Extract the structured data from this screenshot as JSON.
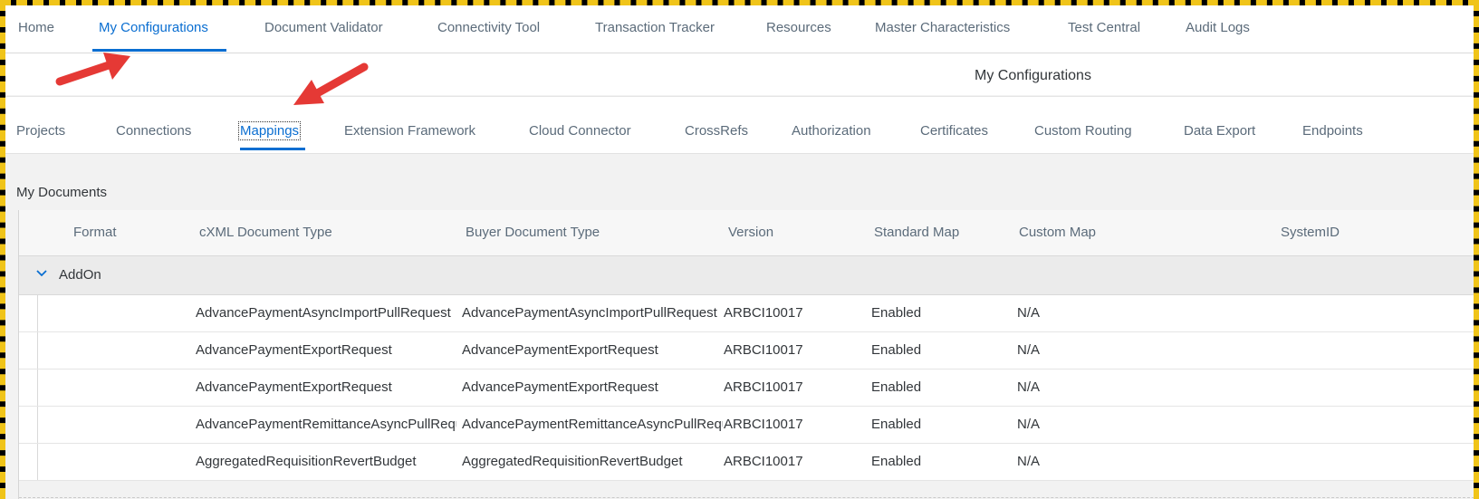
{
  "top_nav": {
    "tabs": [
      {
        "label": "Home"
      },
      {
        "label": "My Configurations",
        "active": true
      },
      {
        "label": "Document Validator"
      },
      {
        "label": "Connectivity Tool"
      },
      {
        "label": "Transaction Tracker"
      },
      {
        "label": "Resources"
      },
      {
        "label": "Master Characteristics"
      },
      {
        "label": "Test Central"
      },
      {
        "label": "Audit Logs"
      }
    ]
  },
  "page": {
    "title": "My Configurations"
  },
  "sub_nav": {
    "tabs": [
      {
        "label": "Projects"
      },
      {
        "label": "Connections"
      },
      {
        "label": "Mappings",
        "active": true
      },
      {
        "label": "Extension Framework"
      },
      {
        "label": "Cloud Connector"
      },
      {
        "label": "CrossRefs"
      },
      {
        "label": "Authorization"
      },
      {
        "label": "Certificates"
      },
      {
        "label": "Custom Routing"
      },
      {
        "label": "Data Export"
      },
      {
        "label": "Endpoints"
      }
    ]
  },
  "documents": {
    "section_title": "My Documents",
    "columns": [
      "Format",
      "cXML Document Type",
      "Buyer Document Type",
      "Version",
      "Standard Map",
      "Custom Map",
      "SystemID"
    ],
    "group": {
      "label": "AddOn",
      "icon": "chevron-down-icon"
    },
    "rows": [
      {
        "format": "",
        "cxml_type": "AdvancePaymentAsyncImportPullRequest",
        "buyer_type": "AdvancePaymentAsyncImportPullRequest",
        "version": "ARBCI10017",
        "standard_map": "Enabled",
        "custom_map": "N/A",
        "system_id": ""
      },
      {
        "format": "",
        "cxml_type": "AdvancePaymentExportRequest",
        "buyer_type": "AdvancePaymentExportRequest",
        "version": "ARBCI10017",
        "standard_map": "Enabled",
        "custom_map": "N/A",
        "system_id": ""
      },
      {
        "format": "",
        "cxml_type": "AdvancePaymentExportRequest",
        "buyer_type": "AdvancePaymentExportRequest",
        "version": "ARBCI10017",
        "standard_map": "Enabled",
        "custom_map": "N/A",
        "system_id": ""
      },
      {
        "format": "",
        "cxml_type": "AdvancePaymentRemittanceAsyncPullRequest",
        "buyer_type": "AdvancePaymentRemittanceAsyncPullRequest",
        "version": "ARBCI10017",
        "standard_map": "Enabled",
        "custom_map": "N/A",
        "system_id": ""
      },
      {
        "format": "",
        "cxml_type": "AggregatedRequisitionRevertBudget",
        "buyer_type": "AggregatedRequisitionRevertBudget",
        "version": "ARBCI10017",
        "standard_map": "Enabled",
        "custom_map": "N/A",
        "system_id": ""
      }
    ]
  },
  "colors": {
    "accent": "#0a6ed1",
    "annotation_arrow": "#e53935",
    "frame_dash": "#f0c419"
  }
}
